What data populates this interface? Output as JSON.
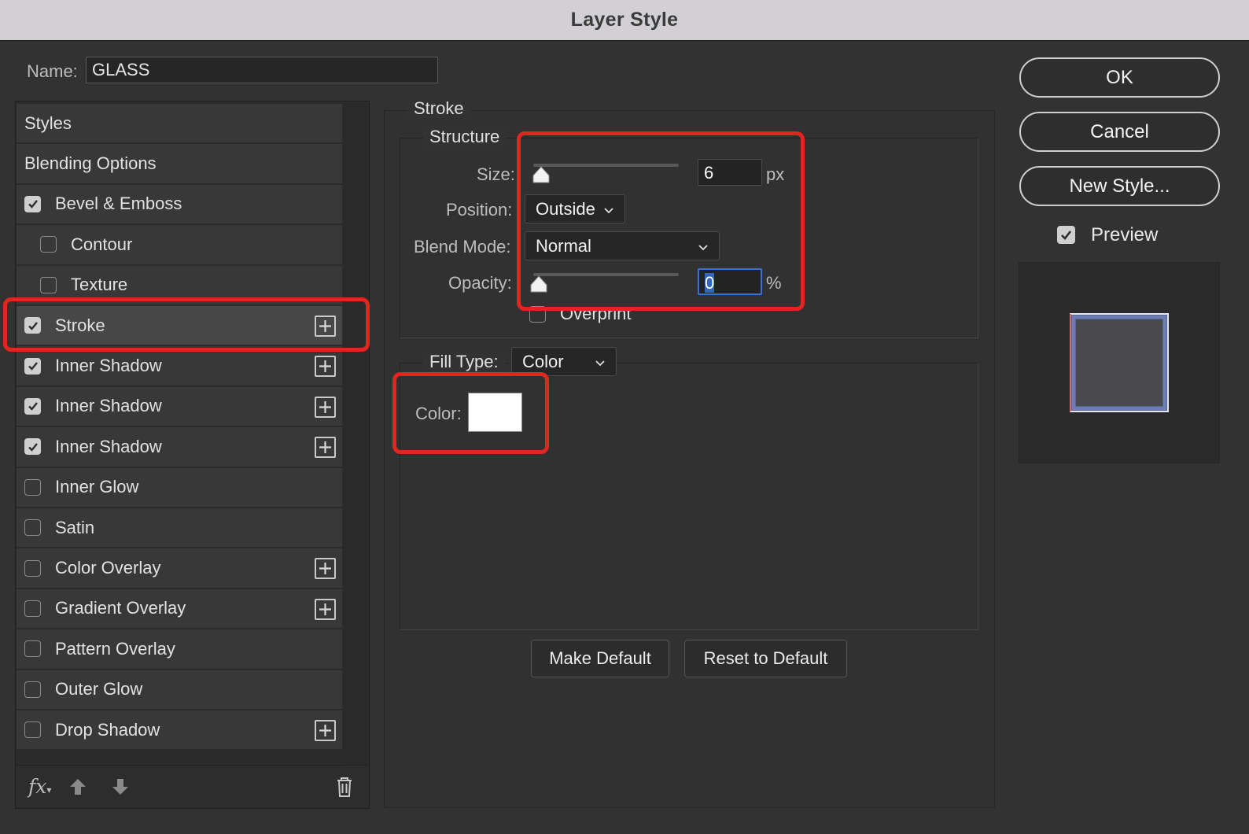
{
  "window": {
    "title": "Layer Style"
  },
  "name": {
    "label": "Name:",
    "value": "GLASS"
  },
  "styles_list": {
    "items": [
      {
        "label": "Styles",
        "checkbox": false,
        "checked": false,
        "indent": false,
        "plus": false,
        "selected": false
      },
      {
        "label": "Blending Options",
        "checkbox": false,
        "checked": false,
        "indent": false,
        "plus": false,
        "selected": false
      },
      {
        "label": "Bevel & Emboss",
        "checkbox": true,
        "checked": true,
        "indent": false,
        "plus": false,
        "selected": false
      },
      {
        "label": "Contour",
        "checkbox": true,
        "checked": false,
        "indent": true,
        "plus": false,
        "selected": false
      },
      {
        "label": "Texture",
        "checkbox": true,
        "checked": false,
        "indent": true,
        "plus": false,
        "selected": false
      },
      {
        "label": "Stroke",
        "checkbox": true,
        "checked": true,
        "indent": false,
        "plus": true,
        "selected": true
      },
      {
        "label": "Inner Shadow",
        "checkbox": true,
        "checked": true,
        "indent": false,
        "plus": true,
        "selected": false
      },
      {
        "label": "Inner Shadow",
        "checkbox": true,
        "checked": true,
        "indent": false,
        "plus": true,
        "selected": false
      },
      {
        "label": "Inner Shadow",
        "checkbox": true,
        "checked": true,
        "indent": false,
        "plus": true,
        "selected": false
      },
      {
        "label": "Inner Glow",
        "checkbox": true,
        "checked": false,
        "indent": false,
        "plus": false,
        "selected": false
      },
      {
        "label": "Satin",
        "checkbox": true,
        "checked": false,
        "indent": false,
        "plus": false,
        "selected": false
      },
      {
        "label": "Color Overlay",
        "checkbox": true,
        "checked": false,
        "indent": false,
        "plus": true,
        "selected": false
      },
      {
        "label": "Gradient Overlay",
        "checkbox": true,
        "checked": false,
        "indent": false,
        "plus": true,
        "selected": false
      },
      {
        "label": "Pattern Overlay",
        "checkbox": true,
        "checked": false,
        "indent": false,
        "plus": false,
        "selected": false
      },
      {
        "label": "Outer Glow",
        "checkbox": true,
        "checked": false,
        "indent": false,
        "plus": false,
        "selected": false
      },
      {
        "label": "Drop Shadow",
        "checkbox": true,
        "checked": false,
        "indent": false,
        "plus": true,
        "selected": false
      }
    ]
  },
  "bottom_toolbar": {
    "fx_icon": "fx-icon",
    "up_icon": "arrow-up-icon",
    "down_icon": "arrow-down-icon",
    "trash_icon": "trash-icon"
  },
  "stroke": {
    "title": "Stroke",
    "structure": {
      "legend": "Structure",
      "size_label": "Size:",
      "size_value": "6",
      "size_unit": "px",
      "size_level": 0.01,
      "position_label": "Position:",
      "position_value": "Outside",
      "blend_label": "Blend Mode:",
      "blend_value": "Normal",
      "opacity_label": "Opacity:",
      "opacity_value": "0",
      "opacity_unit": "%",
      "opacity_level": 0,
      "overprint_label": "Overprint"
    },
    "fill": {
      "legend": "Fill Type:",
      "type_value": "Color",
      "color_label": "Color:",
      "color_value": "#ffffff"
    },
    "make_default": "Make Default",
    "reset_default": "Reset to Default"
  },
  "buttons": {
    "ok": "OK",
    "cancel": "Cancel",
    "new_style": "New Style..."
  },
  "preview": {
    "label": "Preview",
    "checked": true
  },
  "colors": {
    "highlight": "#e0261f",
    "focus": "#3a70d8",
    "title_bar": "#d2d0d4"
  }
}
